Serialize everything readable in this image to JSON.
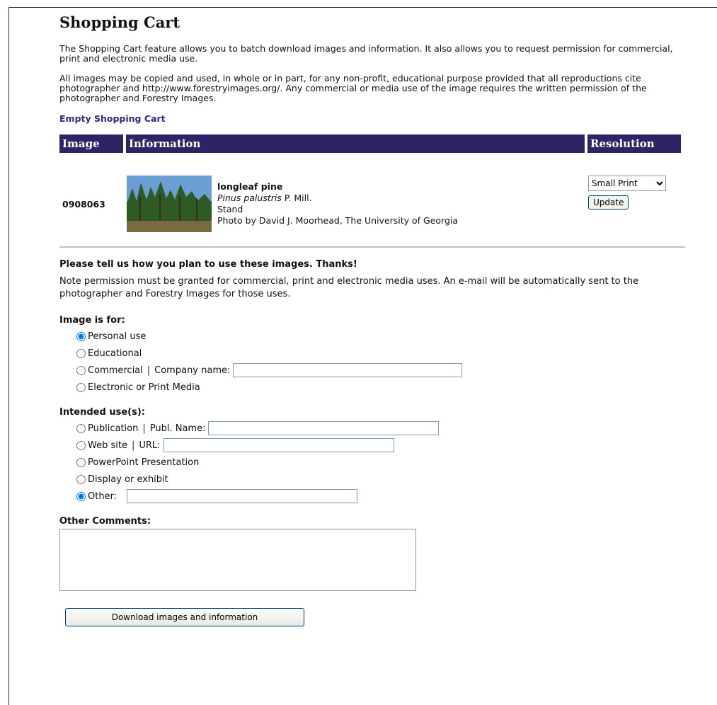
{
  "page": {
    "title": "Shopping Cart",
    "intro_1": "The Shopping Cart feature allows you to batch download images and information. It also allows you to request permission for commercial, print and electronic media use.",
    "intro_2": "All images may be copied and used, in whole or in part, for any non-profit, educational purpose provided that all reproductions cite photographer and http://www.forestryimages.org/. Any commercial or media use of the image requires the written permission of the photographer and Forestry Images.",
    "empty_cart_link": "Empty Shopping Cart"
  },
  "cart": {
    "headers": [
      "Image",
      "Information",
      "Resolution"
    ],
    "items": [
      {
        "id": "0908063",
        "common_name": "longleaf pine",
        "scientific_name": "Pinus palustris",
        "authority": "P. Mill.",
        "descriptor": "Stand",
        "credit": "Photo by David J. Moorhead, The University of Georgia",
        "resolution": "Small Print",
        "update_label": "Update"
      }
    ]
  },
  "usage": {
    "prompt": "Please tell us how you plan to use these images. Thanks!",
    "note": "Note permission must be granted for commercial, print and electronic media uses. An e-mail will be automatically sent to the photographer and Forestry Images for those uses.",
    "image_for": {
      "label": "Image is for:",
      "options": [
        "Personal use",
        "Educational",
        "Commercial",
        "Electronic or Print Media"
      ],
      "selected": "Personal use",
      "company_label": "Company name:",
      "company_value": ""
    },
    "intended": {
      "label": "Intended use(s):",
      "options": [
        "Publication",
        "Web site",
        "PowerPoint Presentation",
        "Display or exhibit",
        "Other:"
      ],
      "selected": "Other:",
      "publ_label": "Publ. Name:",
      "publ_value": "",
      "url_label": "URL:",
      "url_value": "",
      "other_value": ""
    },
    "comments": {
      "label": "Other Comments:",
      "value": ""
    },
    "download_label": "Download images and information"
  }
}
